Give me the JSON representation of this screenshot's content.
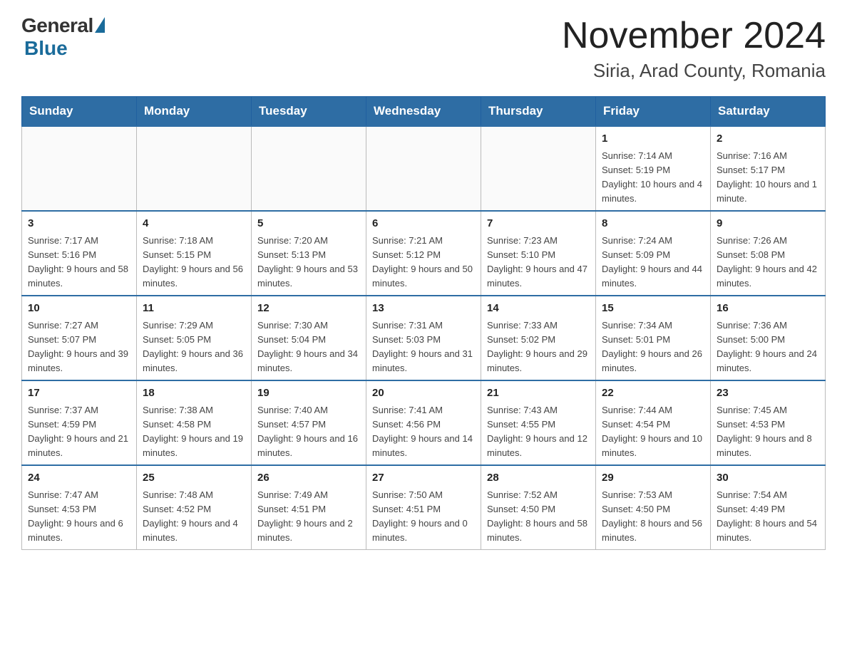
{
  "header": {
    "logo_general": "General",
    "logo_blue": "Blue",
    "month_title": "November 2024",
    "location": "Siria, Arad County, Romania"
  },
  "weekdays": [
    "Sunday",
    "Monday",
    "Tuesday",
    "Wednesday",
    "Thursday",
    "Friday",
    "Saturday"
  ],
  "weeks": [
    [
      {
        "day": "",
        "info": ""
      },
      {
        "day": "",
        "info": ""
      },
      {
        "day": "",
        "info": ""
      },
      {
        "day": "",
        "info": ""
      },
      {
        "day": "",
        "info": ""
      },
      {
        "day": "1",
        "info": "Sunrise: 7:14 AM\nSunset: 5:19 PM\nDaylight: 10 hours and 4 minutes."
      },
      {
        "day": "2",
        "info": "Sunrise: 7:16 AM\nSunset: 5:17 PM\nDaylight: 10 hours and 1 minute."
      }
    ],
    [
      {
        "day": "3",
        "info": "Sunrise: 7:17 AM\nSunset: 5:16 PM\nDaylight: 9 hours and 58 minutes."
      },
      {
        "day": "4",
        "info": "Sunrise: 7:18 AM\nSunset: 5:15 PM\nDaylight: 9 hours and 56 minutes."
      },
      {
        "day": "5",
        "info": "Sunrise: 7:20 AM\nSunset: 5:13 PM\nDaylight: 9 hours and 53 minutes."
      },
      {
        "day": "6",
        "info": "Sunrise: 7:21 AM\nSunset: 5:12 PM\nDaylight: 9 hours and 50 minutes."
      },
      {
        "day": "7",
        "info": "Sunrise: 7:23 AM\nSunset: 5:10 PM\nDaylight: 9 hours and 47 minutes."
      },
      {
        "day": "8",
        "info": "Sunrise: 7:24 AM\nSunset: 5:09 PM\nDaylight: 9 hours and 44 minutes."
      },
      {
        "day": "9",
        "info": "Sunrise: 7:26 AM\nSunset: 5:08 PM\nDaylight: 9 hours and 42 minutes."
      }
    ],
    [
      {
        "day": "10",
        "info": "Sunrise: 7:27 AM\nSunset: 5:07 PM\nDaylight: 9 hours and 39 minutes."
      },
      {
        "day": "11",
        "info": "Sunrise: 7:29 AM\nSunset: 5:05 PM\nDaylight: 9 hours and 36 minutes."
      },
      {
        "day": "12",
        "info": "Sunrise: 7:30 AM\nSunset: 5:04 PM\nDaylight: 9 hours and 34 minutes."
      },
      {
        "day": "13",
        "info": "Sunrise: 7:31 AM\nSunset: 5:03 PM\nDaylight: 9 hours and 31 minutes."
      },
      {
        "day": "14",
        "info": "Sunrise: 7:33 AM\nSunset: 5:02 PM\nDaylight: 9 hours and 29 minutes."
      },
      {
        "day": "15",
        "info": "Sunrise: 7:34 AM\nSunset: 5:01 PM\nDaylight: 9 hours and 26 minutes."
      },
      {
        "day": "16",
        "info": "Sunrise: 7:36 AM\nSunset: 5:00 PM\nDaylight: 9 hours and 24 minutes."
      }
    ],
    [
      {
        "day": "17",
        "info": "Sunrise: 7:37 AM\nSunset: 4:59 PM\nDaylight: 9 hours and 21 minutes."
      },
      {
        "day": "18",
        "info": "Sunrise: 7:38 AM\nSunset: 4:58 PM\nDaylight: 9 hours and 19 minutes."
      },
      {
        "day": "19",
        "info": "Sunrise: 7:40 AM\nSunset: 4:57 PM\nDaylight: 9 hours and 16 minutes."
      },
      {
        "day": "20",
        "info": "Sunrise: 7:41 AM\nSunset: 4:56 PM\nDaylight: 9 hours and 14 minutes."
      },
      {
        "day": "21",
        "info": "Sunrise: 7:43 AM\nSunset: 4:55 PM\nDaylight: 9 hours and 12 minutes."
      },
      {
        "day": "22",
        "info": "Sunrise: 7:44 AM\nSunset: 4:54 PM\nDaylight: 9 hours and 10 minutes."
      },
      {
        "day": "23",
        "info": "Sunrise: 7:45 AM\nSunset: 4:53 PM\nDaylight: 9 hours and 8 minutes."
      }
    ],
    [
      {
        "day": "24",
        "info": "Sunrise: 7:47 AM\nSunset: 4:53 PM\nDaylight: 9 hours and 6 minutes."
      },
      {
        "day": "25",
        "info": "Sunrise: 7:48 AM\nSunset: 4:52 PM\nDaylight: 9 hours and 4 minutes."
      },
      {
        "day": "26",
        "info": "Sunrise: 7:49 AM\nSunset: 4:51 PM\nDaylight: 9 hours and 2 minutes."
      },
      {
        "day": "27",
        "info": "Sunrise: 7:50 AM\nSunset: 4:51 PM\nDaylight: 9 hours and 0 minutes."
      },
      {
        "day": "28",
        "info": "Sunrise: 7:52 AM\nSunset: 4:50 PM\nDaylight: 8 hours and 58 minutes."
      },
      {
        "day": "29",
        "info": "Sunrise: 7:53 AM\nSunset: 4:50 PM\nDaylight: 8 hours and 56 minutes."
      },
      {
        "day": "30",
        "info": "Sunrise: 7:54 AM\nSunset: 4:49 PM\nDaylight: 8 hours and 54 minutes."
      }
    ]
  ]
}
